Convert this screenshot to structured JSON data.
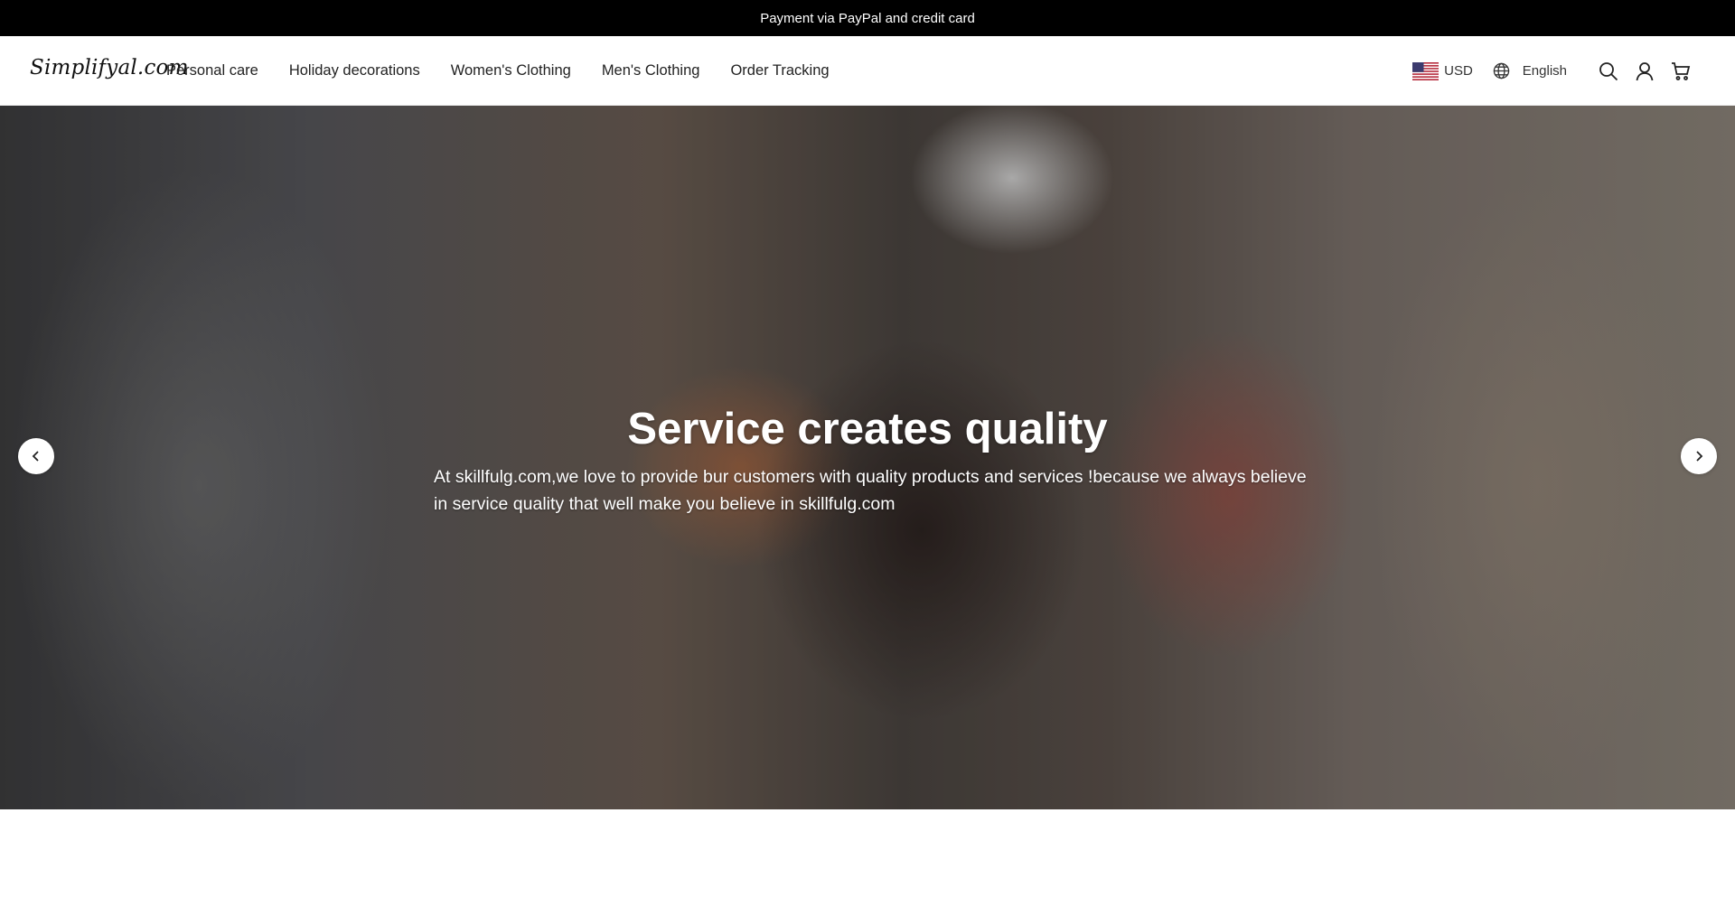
{
  "announcement": {
    "text": "Payment via PayPal and credit card"
  },
  "header": {
    "logo": "Simplifyal.com",
    "nav": [
      {
        "label": "Personal care"
      },
      {
        "label": "Holiday decorations"
      },
      {
        "label": "Women's Clothing"
      },
      {
        "label": "Men's Clothing"
      },
      {
        "label": "Order Tracking"
      }
    ],
    "currency": {
      "label": "USD",
      "flag_icon": "us-flag-icon"
    },
    "language": {
      "label": "English",
      "icon": "globe-icon"
    },
    "icons": [
      "search-icon",
      "account-icon",
      "cart-icon"
    ]
  },
  "hero": {
    "title": "Service creates quality",
    "text": "At skillfulg.com,we love to provide bur customers with quality products and services !because we always believe in service quality that well make you believe in skillfulg.com"
  },
  "colors": {
    "announcement_bg": "#000000",
    "header_bg": "#ffffff",
    "text": "#222222"
  }
}
